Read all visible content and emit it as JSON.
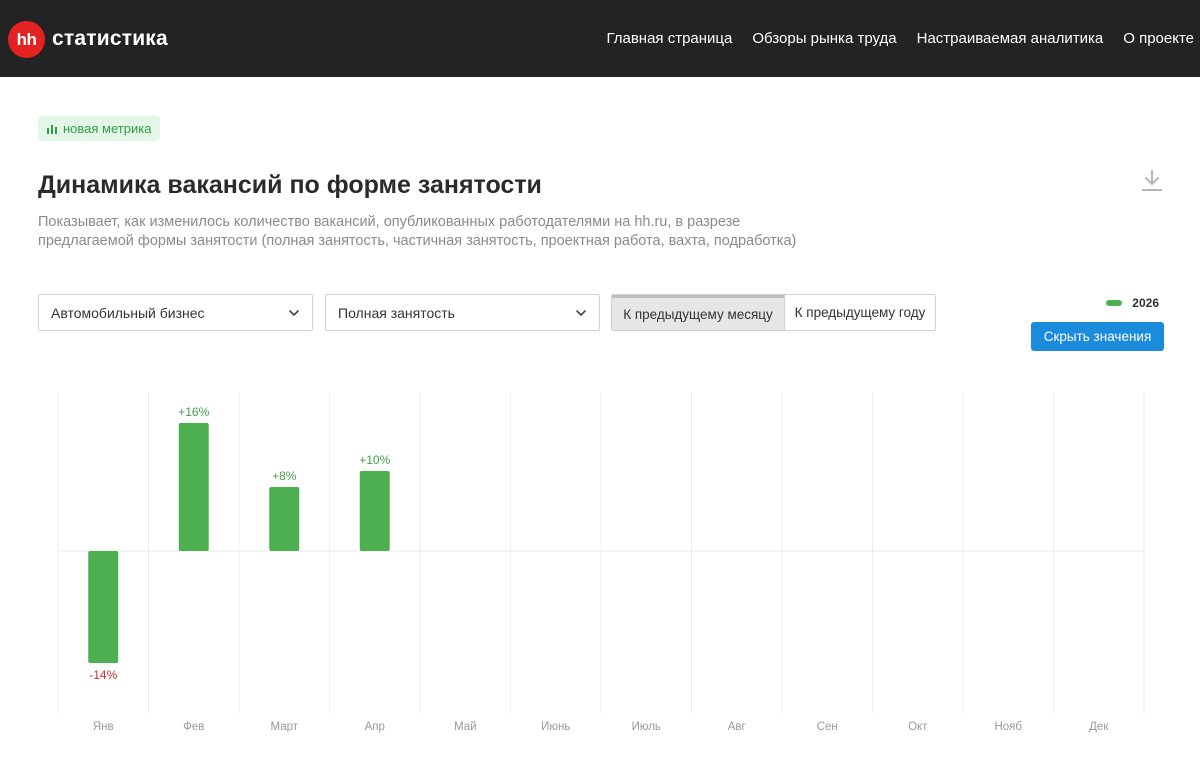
{
  "header": {
    "logo_mark": "hh",
    "logo_text": "статистика",
    "nav": [
      {
        "label": "Главная страница"
      },
      {
        "label": "Обзоры рынка труда"
      },
      {
        "label": "Настраиваемая аналитика"
      },
      {
        "label": "О проекте"
      }
    ]
  },
  "badge": {
    "label": "новая метрика",
    "icon": "bar-chart-icon"
  },
  "title": "Динамика вакансий по форме занятости",
  "description": "Показывает, как изменилось количество вакансий, опубликованных работодателями на hh.ru, в разрезе предлагаемой формы занятости (полная занятость, частичная занятость, проектная работа, вахта, подработка)",
  "filters": {
    "industry": "Автомобильный бизнес",
    "employment_type": "Полная занятость"
  },
  "comparison": {
    "options": [
      "К предыдущему месяцу",
      "К предыдущему году"
    ],
    "selected": "К предыдущему месяцу"
  },
  "hide_values_label": "Скрыть значения",
  "colors": {
    "bar": "#4cb050",
    "positive_label": "#43a047",
    "negative_label": "#d32f2f",
    "button": "#1b8bdc",
    "header_bg": "#232323",
    "logo": "#e32221"
  },
  "chart_data": {
    "type": "bar",
    "categories": [
      "Янв",
      "Фев",
      "Март",
      "Апр",
      "Май",
      "Июнь",
      "Июль",
      "Авг",
      "Сен",
      "Окт",
      "Нояб",
      "Дек"
    ],
    "series": [
      {
        "name": "2026",
        "values": [
          -14,
          16,
          8,
          10,
          null,
          null,
          null,
          null,
          null,
          null,
          null,
          null
        ]
      }
    ],
    "value_labels": [
      "-14%",
      "+16%",
      "+8%",
      "+10%"
    ],
    "ylim": [
      -20,
      20
    ],
    "legend_position": "top-right",
    "grid": true
  }
}
